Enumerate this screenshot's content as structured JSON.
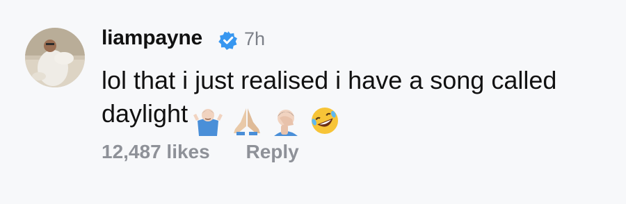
{
  "comment": {
    "username": "liampayne",
    "verified": true,
    "time": "7h",
    "text": "lol that i just realised i have a song called daylight",
    "emojis": [
      "shrug-icon",
      "folded-hands-icon",
      "facepalm-icon",
      "rolling-laugh-icon"
    ],
    "likes": "12,487 likes",
    "reply_label": "Reply"
  },
  "colors": {
    "background": "#f7f8fa",
    "username": "#111111",
    "secondary": "#7b7f87",
    "meta": "#8e9198",
    "verified_badge": "#3897f0"
  }
}
